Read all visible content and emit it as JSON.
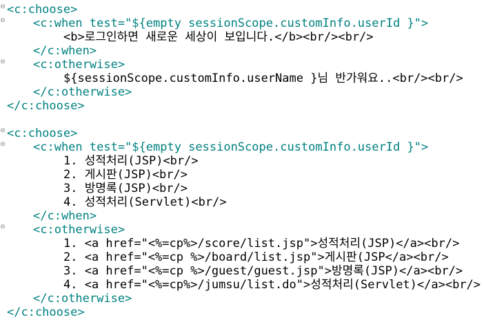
{
  "fold_glyph": "⊖",
  "block1": {
    "choose_open": "<c:choose>",
    "when_open": "<c:when test=\"${empty sessionScope.customInfo.userId }\">",
    "when_body": "<b>로그인하면 새로운 세상이 보입니다.</b><br/><br/>",
    "when_close": "</c:when>",
    "otherwise_open": "<c:otherwise>",
    "otherwise_body": "${sessionScope.customInfo.userName }님 반가워요..<br/><br/>",
    "otherwise_close": "</c:otherwise>",
    "choose_close": "</c:choose>"
  },
  "block2": {
    "choose_open": "<c:choose>",
    "when_open": "<c:when test=\"${empty sessionScope.customInfo.userId }\">",
    "when_items": [
      "1. 성적처리(JSP)<br/>",
      "2. 게시판(JSP)<br/>",
      "3. 방명록(JSP)<br/>",
      "4. 성적처리(Servlet)<br/>"
    ],
    "when_close": "</c:when>",
    "otherwise_open": "<c:otherwise>",
    "otherwise_items": [
      "1. <a href=\"<%=cp%>/score/list.jsp\">성적처리(JSP)</a><br/>",
      "2. <a href=\"<%=cp %>/board/list.jsp\">게시판(JSP</a><br/>",
      "3. <a href=\"<%=cp %>/guest/guest.jsp\">방명록(JSP)</a><br/>",
      "4. <a href=\"<%=cp%>/jumsu/list.do\">성적처리(Servlet)</a><br/>"
    ],
    "otherwise_close": "</c:otherwise>",
    "choose_close": "</c:choose>"
  }
}
